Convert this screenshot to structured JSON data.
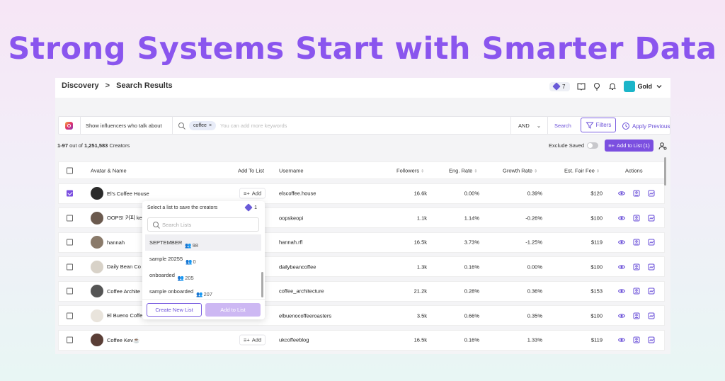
{
  "headline": "Strong Systems Start with Smarter Data",
  "topbar": {
    "breadcrumb_root": "Discovery",
    "breadcrumb_sep": ">",
    "breadcrumb_current": "Search Results",
    "credits": "7",
    "plan": "Gold"
  },
  "search": {
    "mode_label": "Show influencers who talk about",
    "keyword_chip": "coffee",
    "placeholder": "You can add more keywords",
    "operator": "AND",
    "search_label": "Search",
    "filters_label": "Filters",
    "apply_previous_label": "Apply Previous"
  },
  "results": {
    "range": "1-97",
    "out_of": "out of",
    "total": "1,251,583",
    "unit": "Creators",
    "exclude_saved_label": "Exclude Saved",
    "add_to_list_label": "Add to List (1)"
  },
  "table": {
    "headers": {
      "avatar_name": "Avatar & Name",
      "add_to_list": "Add To List",
      "username": "Username",
      "followers": "Followers",
      "eng_rate": "Eng. Rate",
      "growth_rate": "Growth Rate",
      "fair_fee": "Est. Fair Fee",
      "actions": "Actions"
    },
    "add_label": "Add",
    "rows": [
      {
        "name": "El's Coffee House",
        "username": "elscoffee.house",
        "followers": "16.6k",
        "eng": "0.00%",
        "growth": "0.39%",
        "fee": "$120",
        "checked": true,
        "avatar_color": "#2b2b2b",
        "show_add": true
      },
      {
        "name": "OOPS! 커피 ked",
        "username": "oopskeopi",
        "followers": "1.1k",
        "eng": "1.14%",
        "growth": "-0.26%",
        "fee": "$100",
        "checked": false,
        "avatar_color": "#6b5a4e",
        "show_add": false
      },
      {
        "name": "hannah",
        "username": "hannah.rfl",
        "followers": "16.5k",
        "eng": "3.73%",
        "growth": "-1.25%",
        "fee": "$119",
        "checked": false,
        "avatar_color": "#8a7a6a",
        "show_add": false
      },
      {
        "name": "Daily Bean Co",
        "username": "dailybeancoffee",
        "followers": "1.3k",
        "eng": "0.16%",
        "growth": "0.00%",
        "fee": "$100",
        "checked": false,
        "avatar_color": "#d8d2c8",
        "show_add": false
      },
      {
        "name": "Coffee Archite",
        "username": "coffee_architecture",
        "followers": "21.2k",
        "eng": "0.28%",
        "growth": "0.36%",
        "fee": "$153",
        "checked": false,
        "avatar_color": "#555555",
        "show_add": false
      },
      {
        "name": "El Bueno Coffe",
        "username": "elbuenocoffeeroasters",
        "followers": "3.5k",
        "eng": "0.66%",
        "growth": "0.35%",
        "fee": "$100",
        "checked": false,
        "avatar_color": "#e9e4dc",
        "show_add": false
      },
      {
        "name": "Coffee Kev☕",
        "username": "ukcoffeeblog",
        "followers": "16.5k",
        "eng": "0.16%",
        "growth": "1.33%",
        "fee": "$119",
        "checked": false,
        "avatar_color": "#5a3e36",
        "show_add": true
      }
    ]
  },
  "popup": {
    "title": "Select a list to save the creators",
    "credits": "1",
    "search_placeholder": "Search Lists",
    "lists": [
      {
        "name": "SEPTEMBER",
        "count": "98"
      },
      {
        "name": "sample 20255",
        "count": "0"
      },
      {
        "name": "onboarded",
        "count": "205"
      },
      {
        "name": "sample onboarded",
        "count": "207"
      }
    ],
    "create_label": "Create New List",
    "add_label": "Add to List"
  },
  "colors": {
    "accent": "#7b4fe0",
    "headline": "#8a55ee"
  }
}
